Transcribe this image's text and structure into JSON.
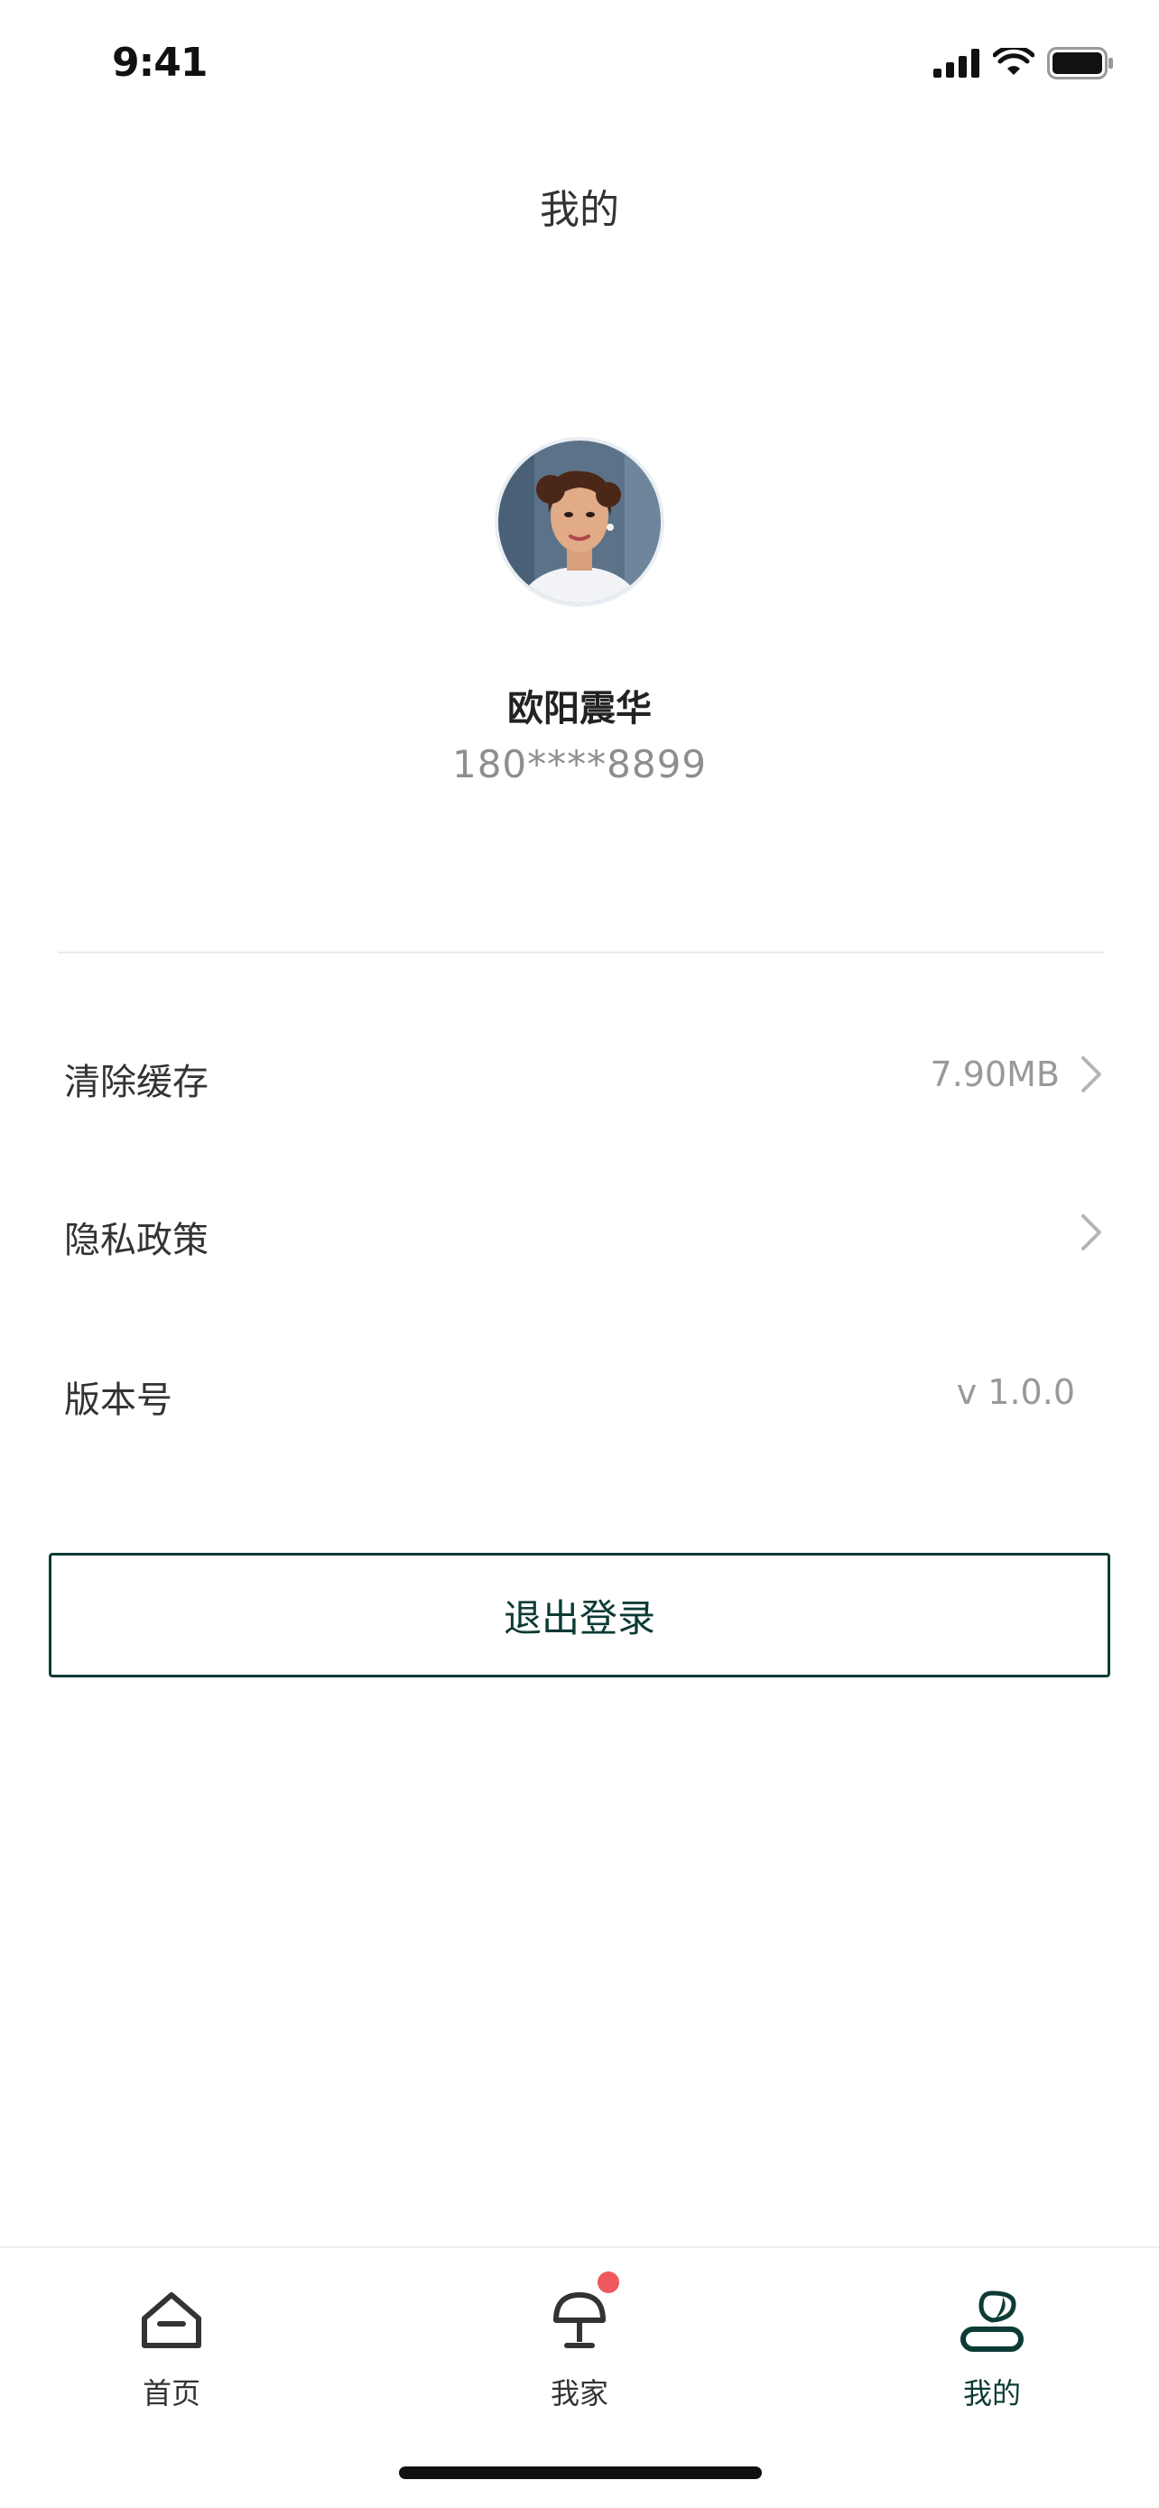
{
  "status_bar": {
    "time": "9:41"
  },
  "header": {
    "title": "我的"
  },
  "profile": {
    "name": "欧阳震华",
    "phone": "180****8899"
  },
  "settings": {
    "items": [
      {
        "label": "清除缓存",
        "value": "7.90MB",
        "chevron": true
      },
      {
        "label": "隐私政策",
        "value": "",
        "chevron": true
      },
      {
        "label": "版本号",
        "value": "v 1.0.0",
        "chevron": false
      }
    ]
  },
  "logout": {
    "label": "退出登录"
  },
  "tabbar": {
    "tabs": [
      {
        "label": "首页",
        "icon": "home-icon",
        "active": false
      },
      {
        "label": "我家",
        "icon": "lamp-icon",
        "active": false,
        "badge": true
      },
      {
        "label": "我的",
        "icon": "profile-icon",
        "active": true
      }
    ]
  },
  "colors": {
    "accent": "#0d3b35",
    "badge": "#f0585f",
    "muted": "#999999"
  }
}
